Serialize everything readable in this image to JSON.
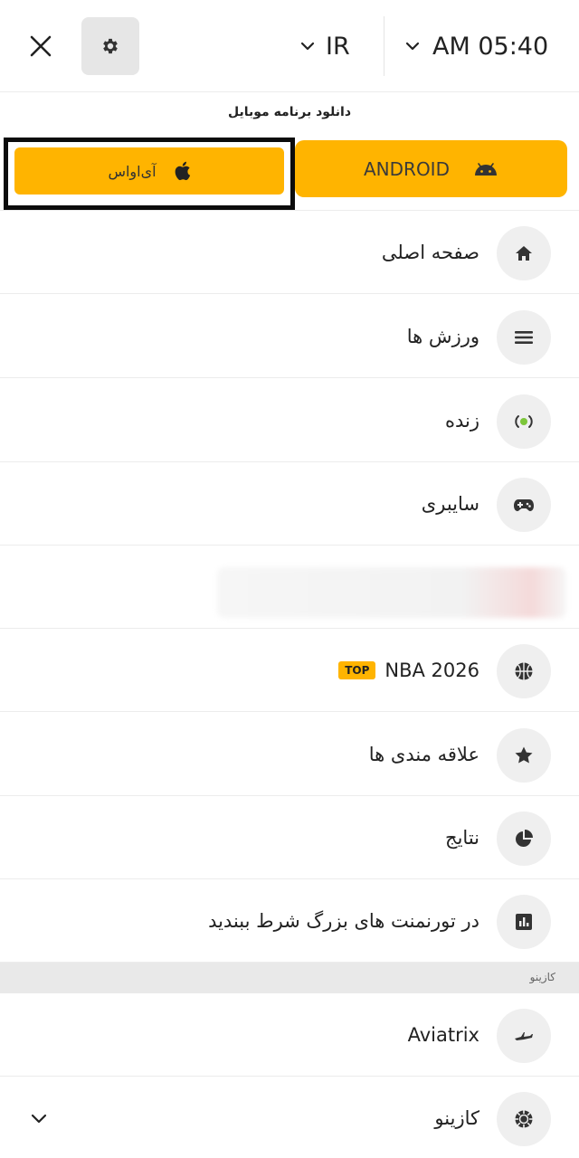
{
  "header": {
    "language": "IR",
    "time": "AM 05:40"
  },
  "download": {
    "title": "دانلود برنامه موبایل",
    "ios_label": "آی‌اواس",
    "android_label": "ANDROID",
    "accent_color": "#ffb400"
  },
  "menu": {
    "items": [
      {
        "label": "صفحه اصلی",
        "icon": "home-icon"
      },
      {
        "label": "ورزش ها",
        "icon": "list-icon"
      },
      {
        "label": "زنده",
        "icon": "live-dot-icon"
      },
      {
        "label": "سایبری",
        "icon": "gamepad-icon"
      },
      {
        "label": "",
        "icon": "blurred-item"
      },
      {
        "label": "NBA 2026",
        "badge": "TOP",
        "icon": "basketball-icon"
      },
      {
        "label": "علاقه مندی ها",
        "icon": "star-icon"
      },
      {
        "label": "نتایج",
        "icon": "pie-chart-icon"
      },
      {
        "label": "در تورنمنت های بزرگ شرط ببندید",
        "icon": "bar-chart-icon"
      }
    ]
  },
  "casino": {
    "section_title": "کازینو",
    "items": [
      {
        "label": "Aviatrix",
        "icon": "plane-icon"
      },
      {
        "label": "کازینو",
        "icon": "casino-chip-icon"
      }
    ]
  }
}
